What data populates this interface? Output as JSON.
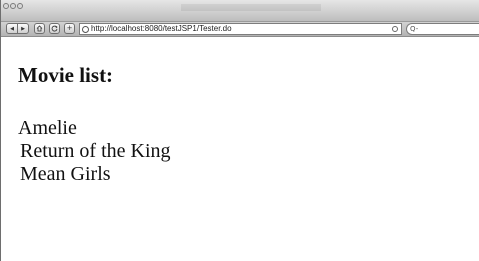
{
  "browser": {
    "url": "http://localhost:8080/testJSP1/Tester.do",
    "buttons": {
      "back_icon": "◀",
      "forward_icon": "▶",
      "home_icon": "home-icon",
      "reload_icon": "reload-icon",
      "add_icon": "+"
    },
    "search_icon": "Q-"
  },
  "page": {
    "heading": "Movie list:",
    "movies": [
      "Amelie",
      "Return of the King",
      "Mean Girls"
    ]
  }
}
